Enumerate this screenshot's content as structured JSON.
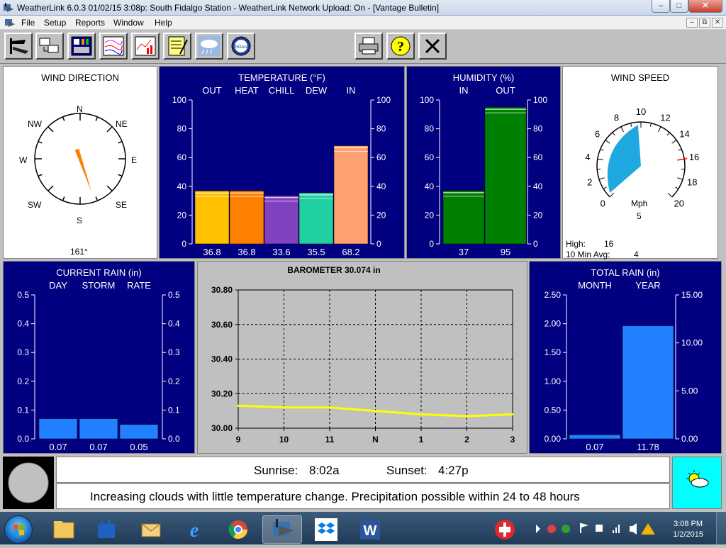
{
  "window": {
    "title": "WeatherLink 6.0.3  01/02/15   3:08p: South Fidalgo Station - WeatherLink Network Upload: On - [Vantage Bulletin]",
    "controls": [
      "–",
      "□",
      "✕"
    ]
  },
  "menu": {
    "items": [
      "File",
      "Setup",
      "Reports",
      "Window",
      "Help"
    ],
    "mdi_controls": [
      "–",
      "⧉",
      "✕"
    ]
  },
  "toolbar": {
    "buttons": [
      "station-icon",
      "download-icon",
      "bulletin-icon",
      "strip-charts-icon",
      "graph-icon",
      "notes-icon",
      "forecast-icon",
      "noaa-icon",
      "print-icon",
      "help-icon",
      "close-icon"
    ]
  },
  "wind_direction": {
    "title": "WIND DIRECTION",
    "compass": [
      "N",
      "NE",
      "E",
      "SE",
      "S",
      "SW",
      "W",
      "NW"
    ],
    "degrees": 161,
    "readout": "161°"
  },
  "temperature": {
    "title": "TEMPERATURE  (°F)",
    "labels": [
      "OUT",
      "HEAT",
      "CHILL",
      "DEW",
      "IN"
    ],
    "ticks": [
      "100",
      "80",
      "60",
      "40",
      "20",
      "0"
    ],
    "values": [
      36.8,
      36.8,
      33.6,
      35.5,
      68.2
    ],
    "value_labels": [
      "36.8",
      "36.8",
      "33.6",
      "35.5",
      "68.2"
    ],
    "colors": [
      "#ffc000",
      "#ff8000",
      "#8040c0",
      "#20d0a0",
      "#ffa070"
    ]
  },
  "humidity": {
    "title": "HUMIDITY  (%)",
    "labels": [
      "IN",
      "OUT"
    ],
    "ticks": [
      "100",
      "80",
      "60",
      "40",
      "20",
      "0"
    ],
    "values": [
      37,
      95
    ],
    "value_labels": [
      "37",
      "95"
    ],
    "color": "#008000"
  },
  "wind_speed": {
    "title": "WIND SPEED",
    "ticks": [
      "0",
      "2",
      "4",
      "6",
      "8",
      "10",
      "12",
      "14",
      "16",
      "18",
      "20"
    ],
    "unit": "Mph",
    "value": "5",
    "high_label": "High:",
    "high_value": "16",
    "avg_label": "10 Min Avg:",
    "avg_value": "4",
    "speed": 5,
    "high": 16
  },
  "current_rain": {
    "title": "CURRENT RAIN  (in)",
    "labels": [
      "DAY",
      "STORM",
      "RATE"
    ],
    "ticks": [
      "0.5",
      "0.4",
      "0.3",
      "0.2",
      "0.1",
      "0.0"
    ],
    "values": [
      0.07,
      0.07,
      0.05
    ],
    "value_labels": [
      "0.07",
      "0.07",
      "0.05"
    ],
    "color": "#2080ff"
  },
  "barometer": {
    "title": "BAROMETER 30.074 in",
    "y_ticks": [
      "30.80",
      "30.60",
      "30.40",
      "30.20",
      "30.00"
    ],
    "x_ticks": [
      "9",
      "10",
      "11",
      "N",
      "1",
      "2",
      "3"
    ]
  },
  "chart_data": {
    "type": "line",
    "x": [
      "9",
      "10",
      "11",
      "N",
      "1",
      "2",
      "3"
    ],
    "ylim": [
      30.0,
      30.8
    ],
    "series": [
      {
        "values": [
          30.13,
          30.12,
          30.12,
          30.1,
          30.08,
          30.07,
          30.08
        ]
      }
    ],
    "color": "#ffff00",
    "grid": true
  },
  "total_rain": {
    "title": "TOTAL RAIN  (in)",
    "labels": [
      "MONTH",
      "YEAR"
    ],
    "left_ticks": [
      "2.50",
      "2.00",
      "1.50",
      "1.00",
      "0.50",
      "0.00"
    ],
    "right_ticks": [
      "15.00",
      "10.00",
      "5.00",
      "0.00"
    ],
    "values": [
      0.07,
      11.78
    ],
    "value_labels": [
      "0.07",
      "11.78"
    ],
    "color": "#2080ff"
  },
  "sun": {
    "sunrise_label": "Sunrise:",
    "sunrise": "8:02a",
    "sunset_label": "Sunset:",
    "sunset": "4:27p"
  },
  "forecast": {
    "text": "Increasing clouds with little temperature change.  Precipitation possible within 24 to 48 hours"
  },
  "taskbar": {
    "apps": [
      "explorer-icon",
      "windows-update-icon",
      "mail-icon",
      "internet-explorer-icon",
      "chrome-icon",
      "weatherlink-icon",
      "dropbox-icon",
      "word-icon",
      "record-icon"
    ],
    "time": "3:08 PM",
    "date": "1/2/2015"
  }
}
